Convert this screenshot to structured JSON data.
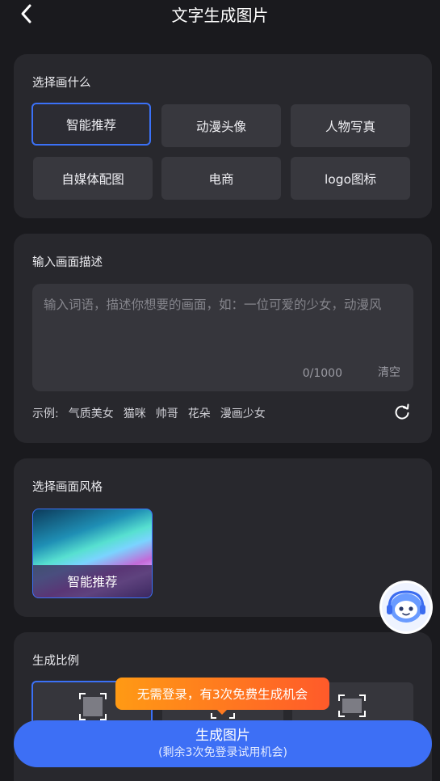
{
  "header": {
    "title": "文字生成图片"
  },
  "category_section": {
    "label": "选择画什么",
    "options": [
      "智能推荐",
      "动漫头像",
      "人物写真",
      "自媒体配图",
      "电商",
      "logo图标"
    ]
  },
  "prompt_section": {
    "label": "输入画面描述",
    "placeholder": "输入词语，描述你想要的画面，如：一位可爱的少女，动漫风",
    "counter": "0/1000",
    "clear_label": "清空",
    "examples_label": "示例:",
    "examples": [
      "气质美女",
      "猫咪",
      "帅哥",
      "花朵",
      "漫画少女"
    ]
  },
  "style_section": {
    "label": "选择画面风格",
    "styles": [
      "智能推荐"
    ]
  },
  "ratio_section": {
    "label": "生成比例"
  },
  "tooltip": {
    "text": "无需登录，有3次免费生成机会"
  },
  "generate_button": {
    "label": "生成图片",
    "sublabel": "(剩余3次免登录试用机会)"
  },
  "colors": {
    "accent": "#3d6ff5",
    "tooltip": "#ff7a20",
    "card": "#28282d",
    "background": "#1a1a1e"
  },
  "icons": [
    "back-icon",
    "refresh-icon",
    "assistant-avatar-icon",
    "frame-icon"
  ]
}
